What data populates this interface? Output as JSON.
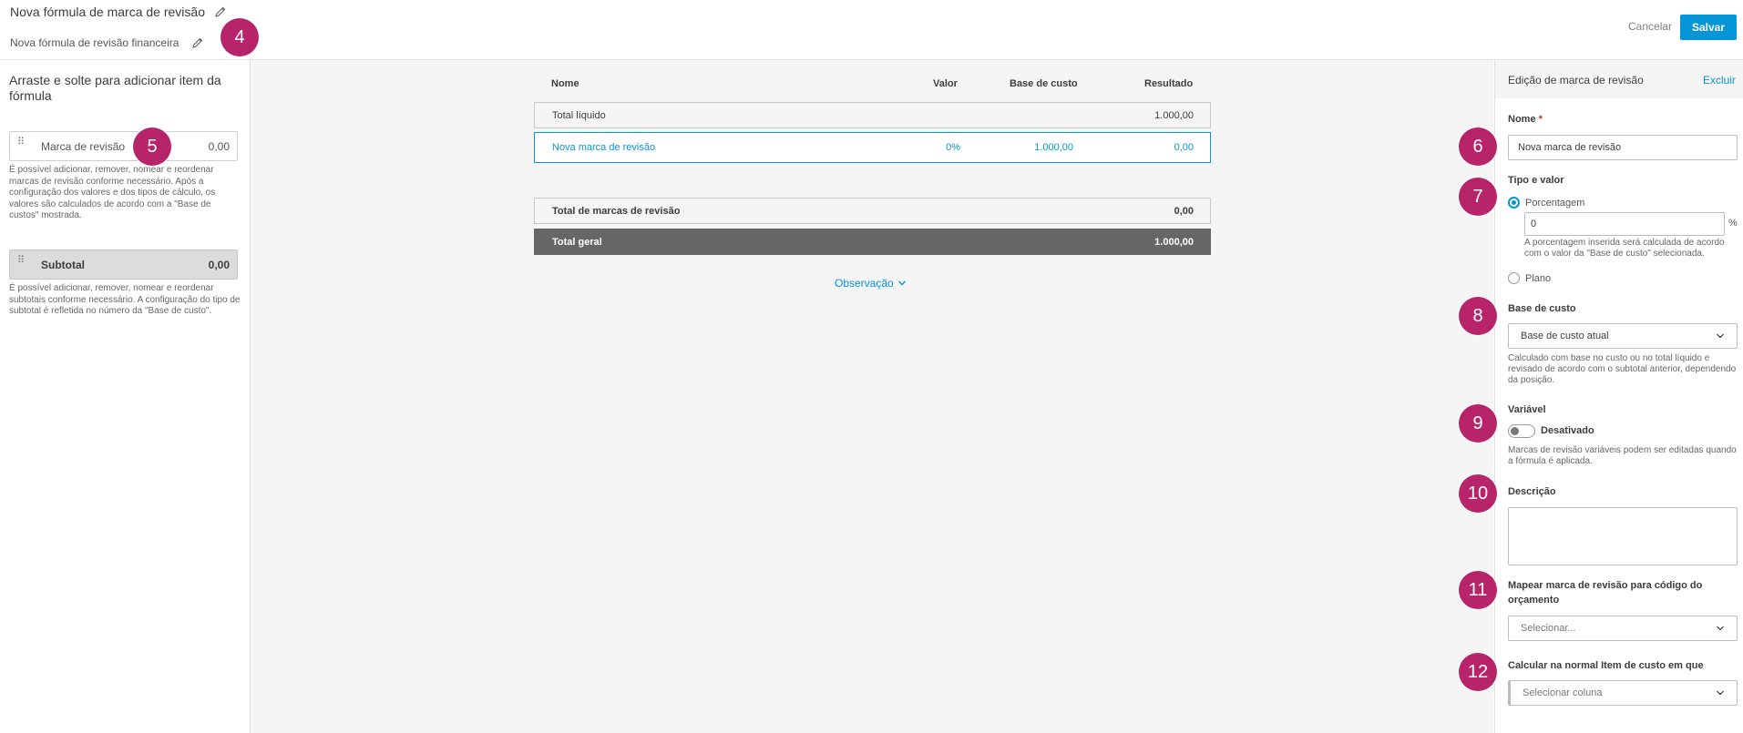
{
  "header": {
    "title": "Nova fórmula de marca de revisão",
    "subtitle": "Nova fórmula de revisão financeira",
    "cancel_label": "Cancelar",
    "save_label": "Salvar"
  },
  "left_panel": {
    "heading": "Arraste e solte para adicionar item da fórmula",
    "markup_card": {
      "label": "Marca de revisão",
      "value": "0,00"
    },
    "markup_help": "É possível adicionar, remover, nomear e reordenar marcas de revisão conforme necessário. Após a configuração dos valores e dos tipos de cálculo, os valores são calculados de acordo com a \"Base de custos\" mostrada.",
    "subtotal_card": {
      "label": "Subtotal",
      "value": "0,00"
    },
    "subtotal_help": "É possível adicionar, remover, nomear e reordenar subtotais conforme necessário. A configuração do tipo de subtotal é refletida no número da \"Base de custo\"."
  },
  "table": {
    "columns": [
      "Nome",
      "Valor",
      "Base de custo",
      "Resultado"
    ],
    "rows": [
      {
        "name": "Total líquido",
        "value": "",
        "base": "",
        "result": "1.000,00"
      },
      {
        "name": "Nova marca de revisão",
        "value": "0%",
        "base": "1.000,00",
        "result": "0,00"
      }
    ],
    "markups_total": {
      "name": "Total de marcas de revisão",
      "result": "0,00"
    },
    "grand_total": {
      "name": "Total geral",
      "result": "1.000,00"
    },
    "observation_label": "Observação"
  },
  "right_panel": {
    "title": "Edição de marca de revisão",
    "delete_label": "Excluir",
    "name_label": "Nome",
    "name_required": "*",
    "name_value": "Nova marca de revisão",
    "type_label": "Tipo e valor",
    "percent_label": "Porcentagem",
    "percent_value": "0",
    "percent_sign": "%",
    "percent_help": "A porcentagem inserida será calculada de acordo com o valor da \"Base de custo\" selecionada.",
    "flat_label": "Plano",
    "cost_base_label": "Base de custo",
    "cost_base_value": "Base de custo atual",
    "cost_base_help": "Calculado com base no custo ou no total líquido e revisado de acordo com o subtotal anterior, dependendo da posição.",
    "variable_label": "Variável",
    "variable_state": "Desativado",
    "variable_help": "Marcas de revisão variáveis podem ser editadas quando a fórmula é aplicada.",
    "description_label": "Descrição",
    "map_label": "Mapear marca de revisão para código do orçamento",
    "map_placeholder": "Selecionar...",
    "calc_label": "Calcular na normal Item de custo em que",
    "calc_placeholder": "Selecionar coluna"
  },
  "markers": [
    "4",
    "5",
    "6",
    "7",
    "8",
    "9",
    "10",
    "11",
    "12"
  ],
  "colors": {
    "accent": "#0696d7",
    "marker": "#b8246a",
    "dark_row": "#666666"
  }
}
